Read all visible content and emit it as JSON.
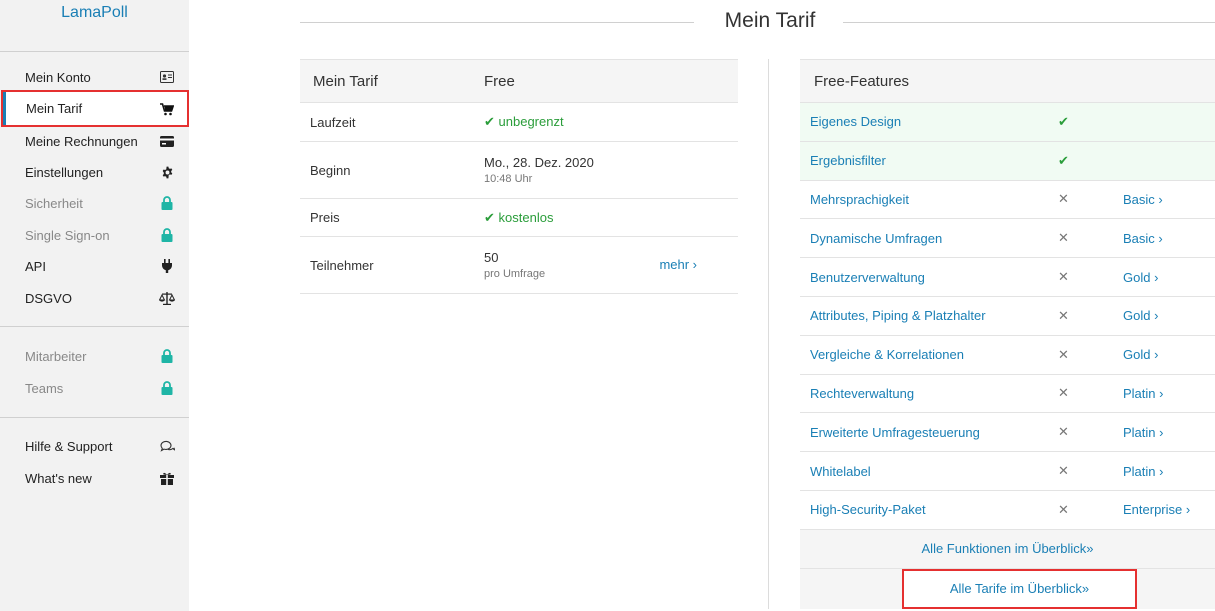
{
  "app": {
    "logo_text": "LamaPoll"
  },
  "sidebar": {
    "group1": [
      {
        "label": "Mein Konto",
        "icon": "id-card-icon"
      },
      {
        "label": "Mein Tarif",
        "icon": "cart-icon",
        "active": true
      },
      {
        "label": "Meine Rechnungen",
        "icon": "credit-card-icon"
      },
      {
        "label": "Einstellungen",
        "icon": "gear-icon"
      },
      {
        "label": "Sicherheit",
        "icon": "lock-icon",
        "locked": true
      },
      {
        "label": "Single Sign-on",
        "icon": "lock-icon",
        "locked": true
      },
      {
        "label": "API",
        "icon": "plug-icon"
      },
      {
        "label": "DSGVO",
        "icon": "scale-icon"
      }
    ],
    "group2": [
      {
        "label": "Mitarbeiter",
        "icon": "lock-icon",
        "locked": true
      },
      {
        "label": "Teams",
        "icon": "lock-icon",
        "locked": true
      }
    ],
    "group3": [
      {
        "label": "Hilfe & Support",
        "icon": "chat-icon"
      },
      {
        "label": "What's new",
        "icon": "gift-icon"
      }
    ]
  },
  "main": {
    "title": "Mein Tarif",
    "tarif": {
      "head_label": "Mein Tarif",
      "head_value": "Free",
      "rows": [
        {
          "label": "Laufzeit",
          "value": "unbegrenzt"
        },
        {
          "label": "Beginn",
          "value": "Mo., 28. Dez. 2020",
          "sub": "10:48 Uhr"
        },
        {
          "label": "Preis",
          "value": "kostenlos"
        },
        {
          "label": "Teilnehmer",
          "value": "50",
          "sub": "pro Umfrage",
          "link": "mehr ›"
        }
      ]
    },
    "features": {
      "head": "Free-Features",
      "rows": [
        {
          "name": "Eigenes Design",
          "included": true,
          "plan": ""
        },
        {
          "name": "Ergebnisfilter",
          "included": true,
          "plan": ""
        },
        {
          "name": "Mehrsprachigkeit",
          "included": false,
          "plan": "Basic ›"
        },
        {
          "name": "Dynamische Umfragen",
          "included": false,
          "plan": "Basic ›"
        },
        {
          "name": "Benutzerverwaltung",
          "included": false,
          "plan": "Gold ›"
        },
        {
          "name": "Attributes, Piping & Platzhalter",
          "included": false,
          "plan": "Gold ›"
        },
        {
          "name": "Vergleiche & Korrelationen",
          "included": false,
          "plan": "Gold ›"
        },
        {
          "name": "Rechteverwaltung",
          "included": false,
          "plan": "Platin ›"
        },
        {
          "name": "Erweiterte Umfragesteuerung",
          "included": false,
          "plan": "Platin ›"
        },
        {
          "name": "Whitelabel",
          "included": false,
          "plan": "Platin ›"
        },
        {
          "name": "High-Security-Paket",
          "included": false,
          "plan": "Enterprise ›"
        }
      ],
      "all_functions": "Alle Funktionen im Überblick»",
      "all_tariffs": "Alle Tarife im Überblick»"
    },
    "colors": {
      "accent": "#1a7fb5",
      "green": "#2a9d3a",
      "lock": "#1fb5a6",
      "highlight": "#e53030"
    }
  }
}
